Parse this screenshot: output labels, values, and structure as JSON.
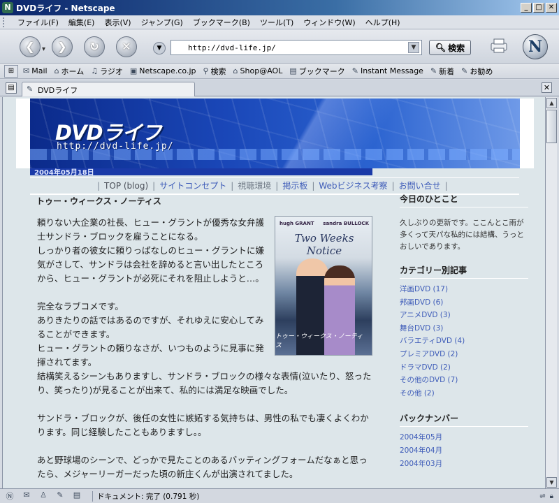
{
  "window": {
    "title": "DVDライフ - Netscape",
    "buttons": [
      "_",
      "□",
      "✕"
    ]
  },
  "menu": [
    "ファイル(F)",
    "編集(E)",
    "表示(V)",
    "ジャンプ(G)",
    "ブックマーク(B)",
    "ツール(T)",
    "ウィンドウ(W)",
    "ヘルプ(H)"
  ],
  "nav": {
    "url": "http://dvd-life.jp/",
    "search_label": "検索"
  },
  "personal_toolbar": [
    {
      "label": "Mail",
      "icon": "mail-icon"
    },
    {
      "label": "ホーム",
      "icon": "home-icon"
    },
    {
      "label": "ラジオ",
      "icon": "radio-icon"
    },
    {
      "label": "Netscape.co.jp",
      "icon": "netscape-icon"
    },
    {
      "label": "検索",
      "icon": "search-icon"
    },
    {
      "label": "Shop@AOL",
      "icon": "shop-icon"
    },
    {
      "label": "ブックマーク",
      "icon": "folder-icon"
    },
    {
      "label": "Instant Message",
      "icon": "bookmark-icon"
    },
    {
      "label": "新着",
      "icon": "bookmark-icon"
    },
    {
      "label": "お勧め",
      "icon": "bookmark-icon"
    }
  ],
  "tab": {
    "label": "DVDライフ"
  },
  "site": {
    "logo": "DVDライフ",
    "url": "http://dvd-life.jp/",
    "date": "2004年05月18日",
    "nav_links": [
      "TOP (blog)",
      "サイトコンセプト",
      "視聴環境",
      "掲示板",
      "Webビジネス考察",
      "お問い合せ"
    ]
  },
  "post": {
    "title": "トゥー・ウィークス・ノーティス",
    "poster": {
      "actor1": "hugh GRANT",
      "actor2": "sandra BULLOCK",
      "title": "Two Weeks Notice",
      "japanese_title": "トゥー・ウィークス・ノーティス"
    },
    "paragraphs": [
      "頼りない大企業の社長、ヒュー・グラントが優秀な女弁護士サンドラ・ブロックを雇うことになる。",
      "しっかり者の彼女に頼りっぱなしのヒュー・グラントに嫌気がさして、サンドラは会社を辞めると言い出したところから、ヒュー・グラントが必死にそれを阻止しようと…。",
      "",
      "完全なラブコメです。",
      "ありきたりの話ではあるのですが、それゆえに安心してみることができます。",
      "ヒュー・グラントの頼りなさが、いつものように見事に発揮されてます。",
      "結構笑えるシーンもありますし、サンドラ・ブロックの様々な表情(泣いたり、怒ったり、笑ったり)が見ることが出来て、私的には満足な映画でした。",
      "",
      "サンドラ・ブロックが、後任の女性に嫉妬する気持ちは、男性の私でも凄くよくわかります。同じ経験したこともありますし。。",
      "",
      "あと野球場のシーンで、どっかで見たことのあるバッティングフォームだなぁと思ったら、メジャーリーガーだった頃の新庄くんが出演されてました。"
    ]
  },
  "sidebar": {
    "hitokoto_title": "今日のひとこと",
    "hitokoto_text": "久しぶりの更新です。ここんとこ雨が多くって天パな私的には結構、うっとおしいであります。",
    "categories_title": "カテゴリー別記事",
    "categories": [
      "洋画DVD (17)",
      "邦画DVD (6)",
      "アニメDVD (3)",
      "舞台DVD (3)",
      "バラエティDVD (4)",
      "プレミアDVD (2)",
      "ドラマDVD (2)",
      "その他のDVD (7)",
      "その他 (2)"
    ],
    "backnumber_title": "バックナンバー",
    "backnumbers": [
      "2004年05月",
      "2004年04月",
      "2004年03月"
    ]
  },
  "status": {
    "text": "ドキュメント: 完了 (0.791 秒)"
  }
}
